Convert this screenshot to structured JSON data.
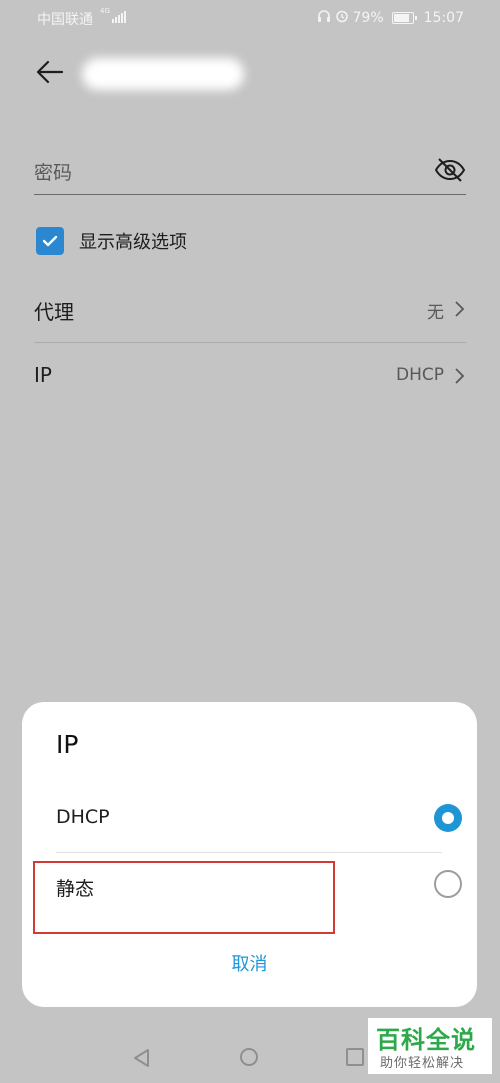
{
  "status_bar": {
    "carrier": "中国联通",
    "network_badge": "4G",
    "battery_percent": "79%",
    "battery_level": 0.79,
    "time": "15:07",
    "icons": [
      "headphones-icon",
      "alarm-icon",
      "battery-icon",
      "signal-icon"
    ]
  },
  "header": {
    "back_icon": "arrow-left-icon"
  },
  "password": {
    "placeholder": "密码",
    "toggle_icon": "eye-off-icon"
  },
  "advanced": {
    "label": "显示高级选项",
    "checked": true
  },
  "settings": {
    "proxy": {
      "label": "代理",
      "value": "无"
    },
    "ip": {
      "label": "IP",
      "value": "DHCP"
    }
  },
  "dialog": {
    "title": "IP",
    "options": [
      {
        "label": "DHCP",
        "selected": true
      },
      {
        "label": "静态",
        "selected": false
      }
    ],
    "cancel_label": "取消",
    "accent_color": "#1e96d6",
    "highlight_color": "#d23a35"
  },
  "nav": {
    "icons": [
      "nav-back-icon",
      "nav-home-icon",
      "nav-recent-icon"
    ]
  },
  "watermark": {
    "main": "百科全说",
    "sub": "助你轻松解决"
  }
}
